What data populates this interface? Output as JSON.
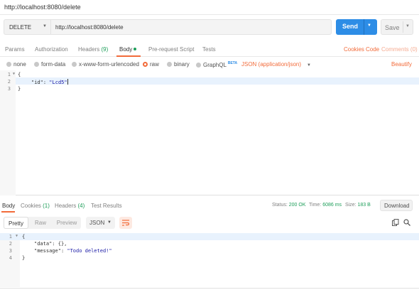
{
  "window": {
    "title": "http://localhost:8080/delete"
  },
  "request": {
    "method": "DELETE",
    "url": "http://localhost:8080/delete",
    "send_label": "Send",
    "save_label": "Save"
  },
  "request_tabs": {
    "params": "Params",
    "authorization": "Authorization",
    "headers": "Headers",
    "headers_count": "(9)",
    "body": "Body",
    "prerequest": "Pre-request Script",
    "tests": "Tests",
    "cookies": "Cookies",
    "code": "Code",
    "comments": "Comments (0)"
  },
  "body_options": {
    "none": "none",
    "form_data": "form-data",
    "urlencoded": "x-www-form-urlencoded",
    "raw": "raw",
    "binary": "binary",
    "graphql": "GraphQL",
    "beta": "BETA",
    "format": "JSON (application/json)",
    "beautify": "Beautify"
  },
  "request_body": {
    "line_numbers": [
      "1",
      "2",
      "3"
    ],
    "line1": "{",
    "line2_key": "\"id\"",
    "line2_sep": ": ",
    "line2_val": "\"Lcd5\"",
    "line3": "}"
  },
  "response_tabs": {
    "body": "Body",
    "cookies": "Cookies",
    "cookies_count": "(1)",
    "headers": "Headers",
    "headers_count": "(4)",
    "test_results": "Test Results"
  },
  "response_status": {
    "status_label": "Status:",
    "status_value": "200 OK",
    "time_label": "Time:",
    "time_value": "6086 ms",
    "size_label": "Size:",
    "size_value": "183 B",
    "download": "Download"
  },
  "view_bar": {
    "pretty": "Pretty",
    "raw": "Raw",
    "preview": "Preview",
    "format": "JSON"
  },
  "response_body": {
    "line_numbers": [
      "1",
      "2",
      "3",
      "4"
    ],
    "line1": "{",
    "line2_key": "\"data\"",
    "line2_rest": ": {},",
    "line3_key": "\"message\"",
    "line3_sep": ": ",
    "line3_val": "\"Todo deleted!\"",
    "line4": "}"
  },
  "colors": {
    "accent": "#f26b3a",
    "send_button": "#2d8de6",
    "success": "#1e9e5a"
  },
  "icons": {
    "copy": "copy-icon",
    "search": "search-icon",
    "wrap": "wrap-lines-icon"
  }
}
